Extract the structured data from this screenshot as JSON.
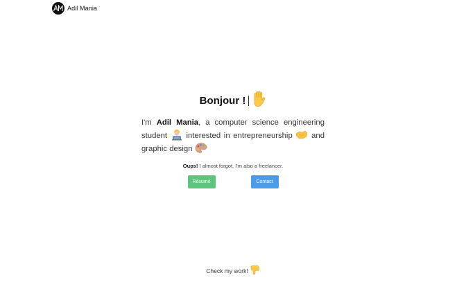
{
  "header": {
    "brand_name": "Adil Mania"
  },
  "hero": {
    "greeting": "Bonjour !",
    "intro": {
      "part1": "I'm ",
      "name": "Adil Mania",
      "part2": ", a computer science engineering student ",
      "part3": " interested in entrepreneurship ",
      "part4": " and graphic design "
    },
    "note": {
      "bold": "Oups!",
      "text": " I almost forgot, I'm also a freelancer."
    }
  },
  "buttons": {
    "resume_label": "Résumé",
    "contact_label": "Contact",
    "resume_color": "#5cc67d",
    "contact_color": "#4a9bea"
  },
  "footer": {
    "cta": "Check my work!"
  },
  "icons": {
    "greeting_emoji": "raised-hand-icon",
    "student_emoji": "technologist-icon",
    "handshake_emoji": "handshake-icon",
    "design_emoji": "artist-palette-icon",
    "check_work_emoji": "pointing-down-icon"
  }
}
